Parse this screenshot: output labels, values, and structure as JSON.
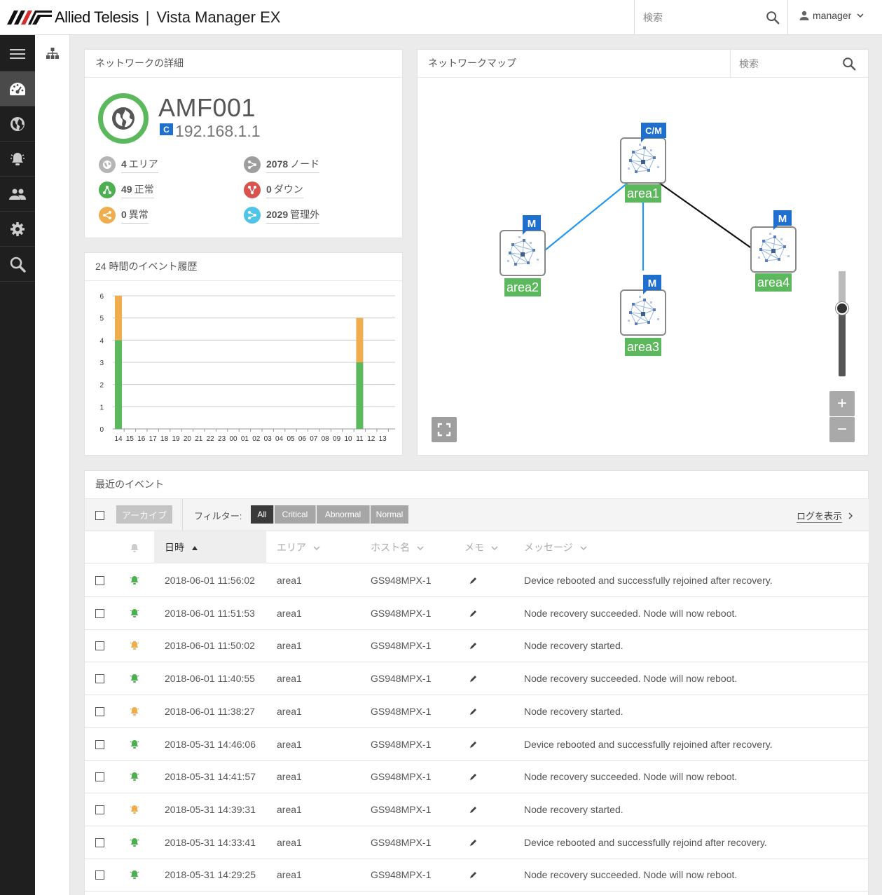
{
  "header": {
    "brand": "Allied Telesis",
    "separator": "|",
    "app_title": "Vista Manager EX",
    "search_placeholder": "検索",
    "user": "manager"
  },
  "sidebar": {
    "items": [
      "menu-icon",
      "dashboard-icon",
      "globe-icon",
      "alarm-icon",
      "people-icon",
      "settings-icon",
      "search-icon"
    ],
    "active": "dashboard-icon"
  },
  "details": {
    "title": "ネットワークの詳細",
    "name": "AMF001",
    "ip": "192.168.1.1",
    "ip_badge": "C",
    "stats": [
      {
        "count": "4",
        "label": "エリア",
        "color": "#b5b5b5"
      },
      {
        "count": "2078",
        "label": "ノード",
        "color": "#9e9e9e"
      },
      {
        "count": "49",
        "label": "正常",
        "color": "#4caf50"
      },
      {
        "count": "0",
        "label": "ダウン",
        "color": "#d9534f"
      },
      {
        "count": "0",
        "label": "異常",
        "color": "#f0ad4e"
      },
      {
        "count": "2029",
        "label": "管理外",
        "color": "#4fc3e8"
      }
    ]
  },
  "history": {
    "title": "24 時間のイベント履歴"
  },
  "chart_data": {
    "type": "bar",
    "stacked": true,
    "categories": [
      "14",
      "15",
      "16",
      "17",
      "18",
      "19",
      "20",
      "21",
      "22",
      "23",
      "00",
      "01",
      "02",
      "03",
      "04",
      "05",
      "06",
      "07",
      "08",
      "09",
      "10",
      "11",
      "12",
      "13"
    ],
    "series": [
      {
        "color": "#5cb85c",
        "values": [
          4,
          0,
          0,
          0,
          0,
          0,
          0,
          0,
          0,
          0,
          0,
          0,
          0,
          0,
          0,
          0,
          0,
          0,
          0,
          0,
          0,
          3,
          0,
          0
        ]
      },
      {
        "color": "#f0ad4e",
        "values": [
          2,
          0,
          0,
          0,
          0,
          0,
          0,
          0,
          0,
          0,
          0,
          0,
          0,
          0,
          0,
          0,
          0,
          0,
          0,
          0,
          0,
          2,
          0,
          0
        ]
      }
    ],
    "ylim": [
      0,
      6
    ],
    "yticks": [
      "0",
      "1",
      "2",
      "3",
      "4",
      "5",
      "6"
    ],
    "grid": true
  },
  "map": {
    "title": "ネットワークマップ",
    "search_placeholder": "検索",
    "zoom_in": "+",
    "zoom_out": "−",
    "nodes": [
      {
        "name": "area1",
        "badge": "C/M"
      },
      {
        "name": "area2",
        "badge": "M"
      },
      {
        "name": "area3",
        "badge": "M"
      },
      {
        "name": "area4",
        "badge": "M"
      }
    ],
    "zoom_level": 0.64
  },
  "events": {
    "title": "最近のイベント",
    "archive": "アーカイブ",
    "filter_label": "フィルター:",
    "filters": [
      "All",
      "Critical",
      "Abnormal",
      "Normal"
    ],
    "active_filter": "All",
    "show_log": "ログを表示",
    "columns": {
      "time": "日時",
      "area": "エリア",
      "host": "ホスト名",
      "memo": "メモ",
      "message": "メッセージ"
    },
    "rows": [
      {
        "level": "normal",
        "time": "2018-06-01 11:56:02",
        "area": "area1",
        "host": "GS948MPX-1",
        "message": "Device rebooted and successfully rejoined after recovery."
      },
      {
        "level": "normal",
        "time": "2018-06-01 11:51:53",
        "area": "area1",
        "host": "GS948MPX-1",
        "message": "Node recovery succeeded. Node will now reboot."
      },
      {
        "level": "abnormal",
        "time": "2018-06-01 11:50:02",
        "area": "area1",
        "host": "GS948MPX-1",
        "message": "Node recovery started."
      },
      {
        "level": "normal",
        "time": "2018-06-01 11:40:55",
        "area": "area1",
        "host": "GS948MPX-1",
        "message": "Node recovery succeeded. Node will now reboot."
      },
      {
        "level": "abnormal",
        "time": "2018-06-01 11:38:27",
        "area": "area1",
        "host": "GS948MPX-1",
        "message": "Node recovery started."
      },
      {
        "level": "normal",
        "time": "2018-05-31 14:46:06",
        "area": "area1",
        "host": "GS948MPX-1",
        "message": "Device rebooted and successfully rejoined after recovery."
      },
      {
        "level": "normal",
        "time": "2018-05-31 14:41:57",
        "area": "area1",
        "host": "GS948MPX-1",
        "message": "Node recovery succeeded. Node will now reboot."
      },
      {
        "level": "abnormal",
        "time": "2018-05-31 14:39:31",
        "area": "area1",
        "host": "GS948MPX-1",
        "message": "Node recovery started."
      },
      {
        "level": "normal",
        "time": "2018-05-31 14:33:41",
        "area": "area1",
        "host": "GS948MPX-1",
        "message": "Device rebooted and successfully rejoind after recovery."
      },
      {
        "level": "normal",
        "time": "2018-05-31 14:29:25",
        "area": "area1",
        "host": "GS948MPX-1",
        "message": "Node recovery succeeded. Node will now reboot."
      }
    ]
  },
  "colors": {
    "normal": "#4caf50",
    "abnormal": "#f0ad4e",
    "accent": "#1f6fcf",
    "sidebar": "#1f1f1f"
  }
}
